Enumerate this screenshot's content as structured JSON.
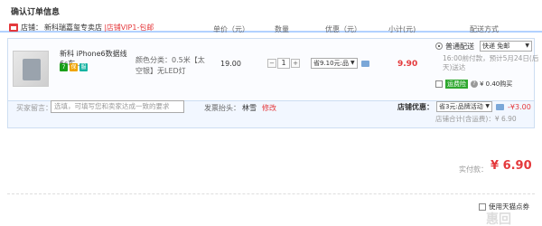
{
  "title": "确认订单信息",
  "columns": {
    "unit_price": "单价（元）",
    "quantity": "数量",
    "discount": "优惠（元）",
    "subtotal": "小计(元)",
    "shipping": "配送方式"
  },
  "shop": {
    "label": "店铺：",
    "name": "新科瑞嘉玺专卖店",
    "vip": "|店铺VIP1-包邮"
  },
  "item": {
    "name": "新科 iPhone6数据线6s车...",
    "spec_lines": [
      "颜色分类：0.5米【太",
      "空银】无LED灯"
    ],
    "price": "19.00",
    "quantity": "1",
    "promo": "省9.10元:品",
    "subtotal": "9.90",
    "shipping_option": "普通配送",
    "shipping_select": "快递 免邮",
    "shipping_note": "16:00前付款，预计5月24日(后天)送达",
    "points_tag": "运费险",
    "points_value": "¥ 0.40购买"
  },
  "message": {
    "label": "买家留言：",
    "placeholder": "选填，可填写您和卖家达成一致的要求"
  },
  "sender": {
    "label": "发票抬头：",
    "name": "林雪",
    "modify": "修改"
  },
  "shop_discount": {
    "label": "店铺优惠：",
    "select": "省3元:品牌活动",
    "amount": "-¥3.00"
  },
  "shop_total": "店铺合计(含运费)：¥ 6.90",
  "payment": {
    "label": "实付款：",
    "amount": "¥ 6.90"
  },
  "coupon_label": "使用天猫点券",
  "watermark": "惠回"
}
